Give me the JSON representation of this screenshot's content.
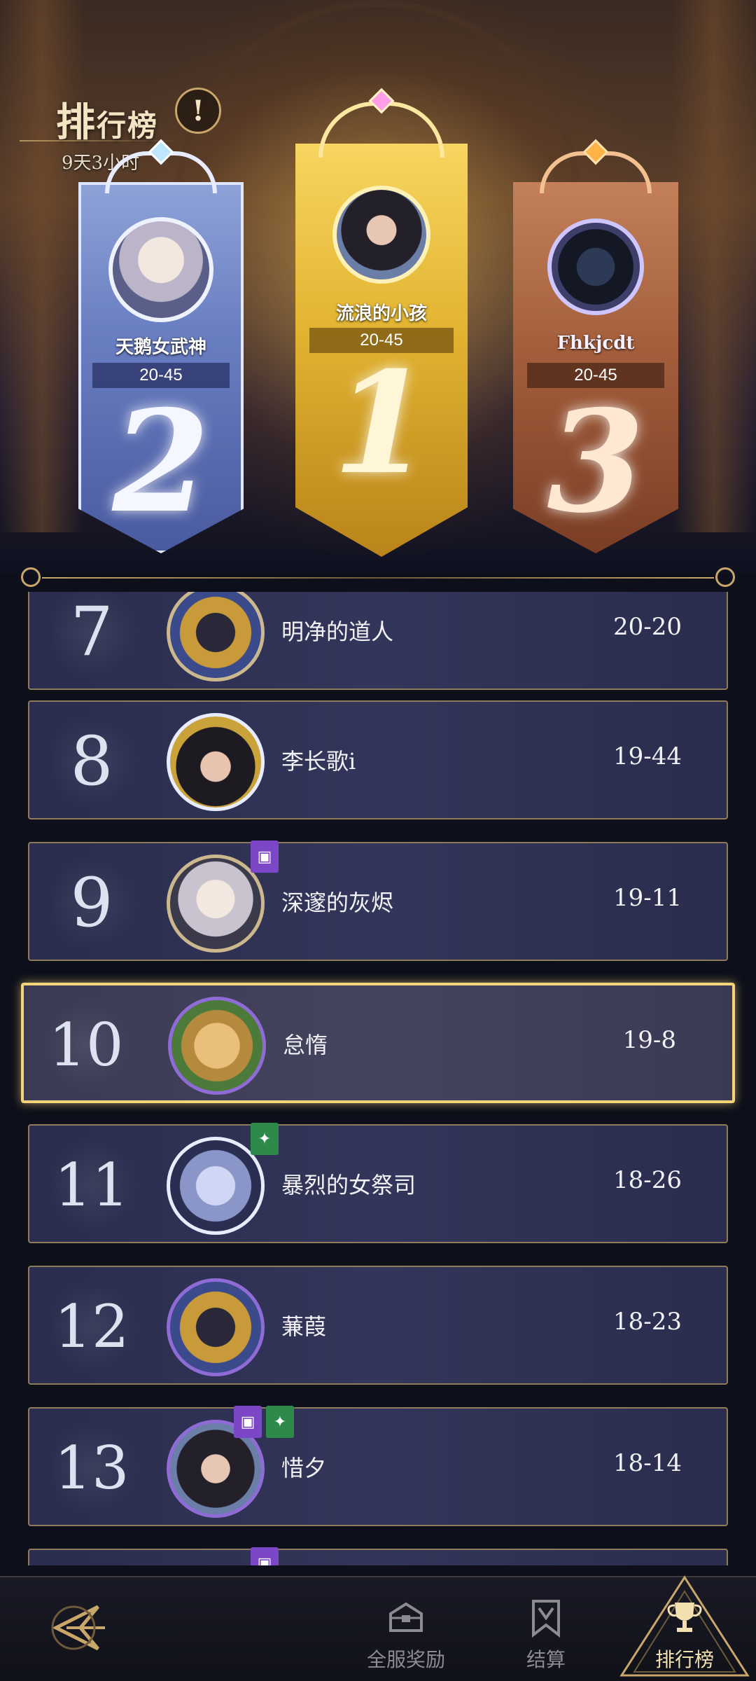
{
  "header": {
    "title_first": "排",
    "title_rest": "行榜",
    "info_icon": "!",
    "timer": "9天3小时"
  },
  "podium": [
    {
      "rank": "2",
      "name": "天鹅女武神",
      "score": "20-45",
      "color": "#6a7fc2"
    },
    {
      "rank": "1",
      "name": "流浪的小孩",
      "score": "20-45",
      "color": "#e2b431"
    },
    {
      "rank": "3",
      "name": "Fhkjcdt",
      "score": "20-45",
      "color": "#a45e3c"
    }
  ],
  "list": [
    {
      "rank": "7",
      "name": "明净的道人",
      "score": "20-20"
    },
    {
      "rank": "8",
      "name": "李长歌i",
      "score": "19-44"
    },
    {
      "rank": "9",
      "name": "深邃的灰烬",
      "score": "19-11"
    },
    {
      "rank": "10",
      "name": "怠惰",
      "score": "19-8"
    },
    {
      "rank": "11",
      "name": "暴烈的女祭司",
      "score": "18-26"
    },
    {
      "rank": "12",
      "name": "蒹葭",
      "score": "18-23"
    },
    {
      "rank": "13",
      "name": "惜夕",
      "score": "18-14"
    }
  ],
  "nav": {
    "rewards": "全服奖励",
    "settle": "结算",
    "rank": "排行榜"
  },
  "colors": {
    "accent_gold": "#f3d47a",
    "badge_purple": "#7b47c7",
    "badge_green": "#2e8a4a"
  }
}
